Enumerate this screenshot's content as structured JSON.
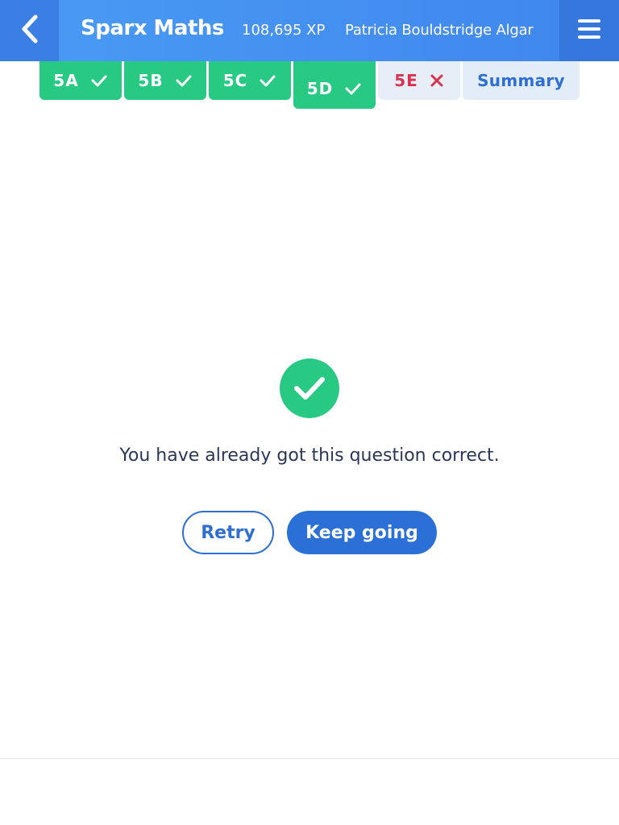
{
  "header": {
    "app_title": "Sparx Maths",
    "xp": "108,695 XP",
    "user_name": "Patricia Bouldstridge Algar",
    "back_icon": "chevron-left-icon",
    "menu_icon": "hamburger-menu-icon"
  },
  "tabs": [
    {
      "label": "5A",
      "status": "correct"
    },
    {
      "label": "5B",
      "status": "correct"
    },
    {
      "label": "5C",
      "status": "correct"
    },
    {
      "label": "5D",
      "status": "correct",
      "current": true
    },
    {
      "label": "5E",
      "status": "incorrect"
    },
    {
      "label": "Summary"
    }
  ],
  "main": {
    "status_icon": "check-circle-icon",
    "message": "You have already got this question correct.",
    "retry_label": "Retry",
    "keep_going_label": "Keep going"
  },
  "colors": {
    "header_blue": "#4a9bf5",
    "success_green": "#27c983",
    "error_red": "#d8324f",
    "primary_blue": "#2a70d6",
    "text_dark": "#2b3758"
  }
}
